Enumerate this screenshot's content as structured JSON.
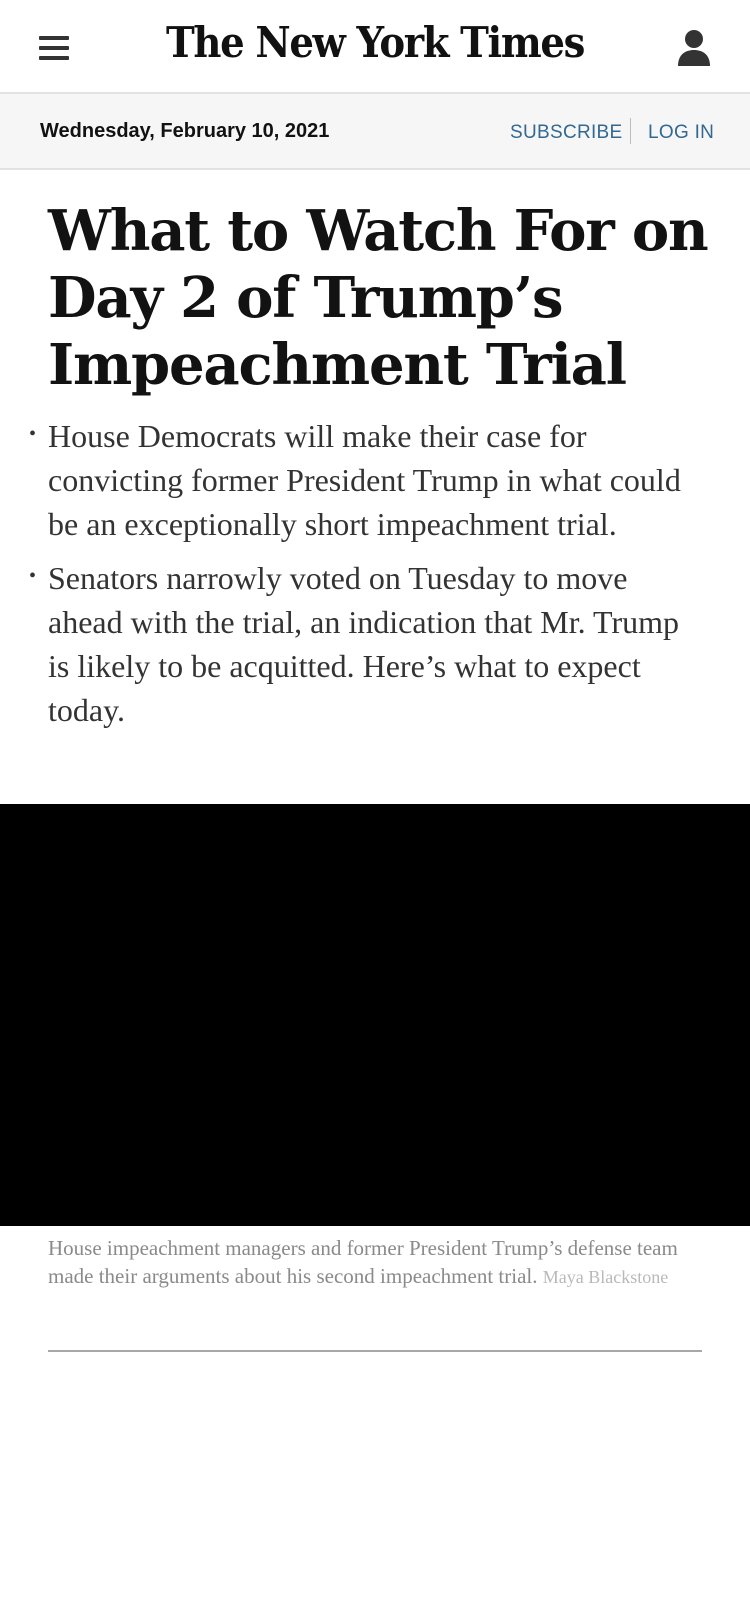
{
  "masthead": {
    "logo_text": "The New York Times",
    "menu_icon": "hamburger-menu-icon",
    "account_icon": "user-account-icon"
  },
  "datebar": {
    "date": "Wednesday, February 10, 2021",
    "subscribe_label": "SUBSCRIBE",
    "login_label": "LOG IN"
  },
  "article": {
    "headline": "What to Watch For on Day 2 of Trump’s Impeachment Trial",
    "summary": [
      "House Democrats will make their case for convicting former President Trump in what could be an exceptionally short impeachment trial.",
      "Senators narrowly voted on Tuesday to move ahead with the trial, an indication that Mr. Trump is likely to be acquitted. Here’s what to expect today."
    ],
    "media": {
      "caption": "House impeachment managers and former President Trump’s defense team made their arguments about his second impeachment trial.",
      "credit": "Maya Blackstone"
    }
  },
  "colors": {
    "link": "#326891",
    "text": "#121212",
    "summary_text": "#333333",
    "caption_text": "#8a8a8a",
    "date_bar_bg": "#f6f6f6",
    "video_bg": "#000000"
  }
}
